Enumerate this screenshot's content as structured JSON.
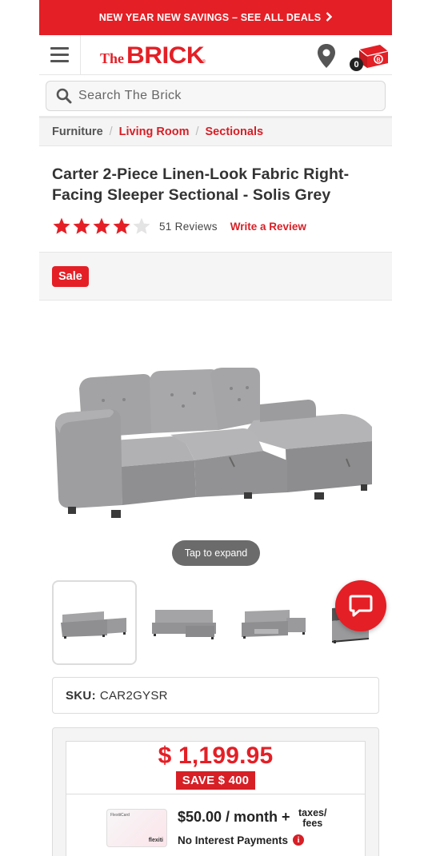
{
  "promo": {
    "text": "NEW YEAR NEW SAVINGS – SEE ALL DEALS",
    "chevron": "chevron-right-icon"
  },
  "header": {
    "logo_the": "The",
    "logo_brick": "BRICK",
    "logo_reg": "®",
    "cart_count": "0"
  },
  "search": {
    "placeholder": "Search The Brick"
  },
  "breadcrumb": {
    "items": [
      "Furniture",
      "Living Room",
      "Sectionals"
    ]
  },
  "product": {
    "title": "Carter 2-Piece Linen-Look Fabric Right-Facing Sleeper Sectional - Solis Grey",
    "rating": 4,
    "rating_max": 5,
    "reviews": "51 Reviews",
    "write_review": "Write a Review",
    "sale_badge": "Sale",
    "tap_expand": "Tap to expand",
    "sku_label": "SKU:",
    "sku": "CAR2GYSR"
  },
  "pricing": {
    "price": "$ 1,199.95",
    "save": "SAVE $ 400",
    "monthly": "$50.00 / month +",
    "taxes": "taxes/\nfees",
    "no_interest": "No Interest Payments",
    "flexiti_brand": "flexiti",
    "flexiti_card_label": "FlexitiCard"
  },
  "colors": {
    "brand_red": "#e41f26",
    "dark_red": "#d71f26",
    "sofa_grey": "#9a9a9c"
  }
}
